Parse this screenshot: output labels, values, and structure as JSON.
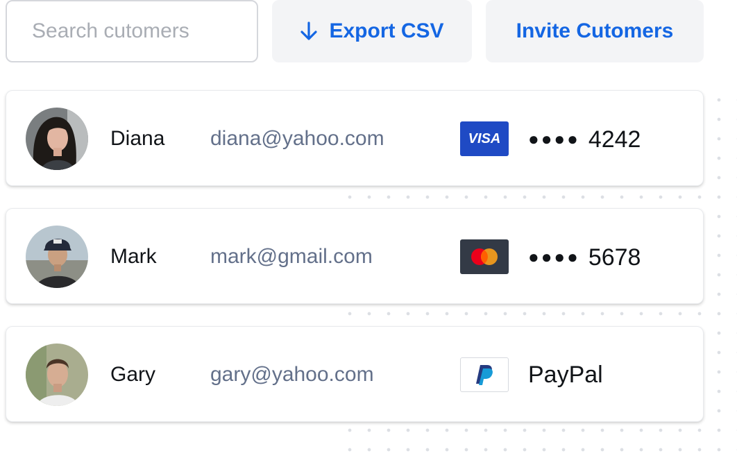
{
  "toolbar": {
    "search_placeholder": "Search cutomers",
    "export_label": "Export CSV",
    "export_icon": "arrow-down-icon",
    "invite_label": "Invite Cutomers"
  },
  "customers": [
    {
      "name": "Diana",
      "email": "diana@yahoo.com",
      "payment_method": "visa",
      "badge_text": "VISA",
      "masked": "●●●●",
      "last4": "4242"
    },
    {
      "name": "Mark",
      "email": "mark@gmail.com",
      "payment_method": "mastercard",
      "masked": "●●●●",
      "last4": "5678"
    },
    {
      "name": "Gary",
      "email": "gary@yahoo.com",
      "payment_method": "paypal",
      "paypal_label": "PayPal"
    }
  ],
  "colors": {
    "accent": "#1466e3",
    "visa": "#1f4ac4",
    "mastercard_bg": "#333a46",
    "mastercard_red": "#eb001b",
    "mastercard_orange": "#f79e1b",
    "paypal_dark": "#253b80",
    "paypal_light": "#179bd7",
    "email_text": "#63708a"
  }
}
